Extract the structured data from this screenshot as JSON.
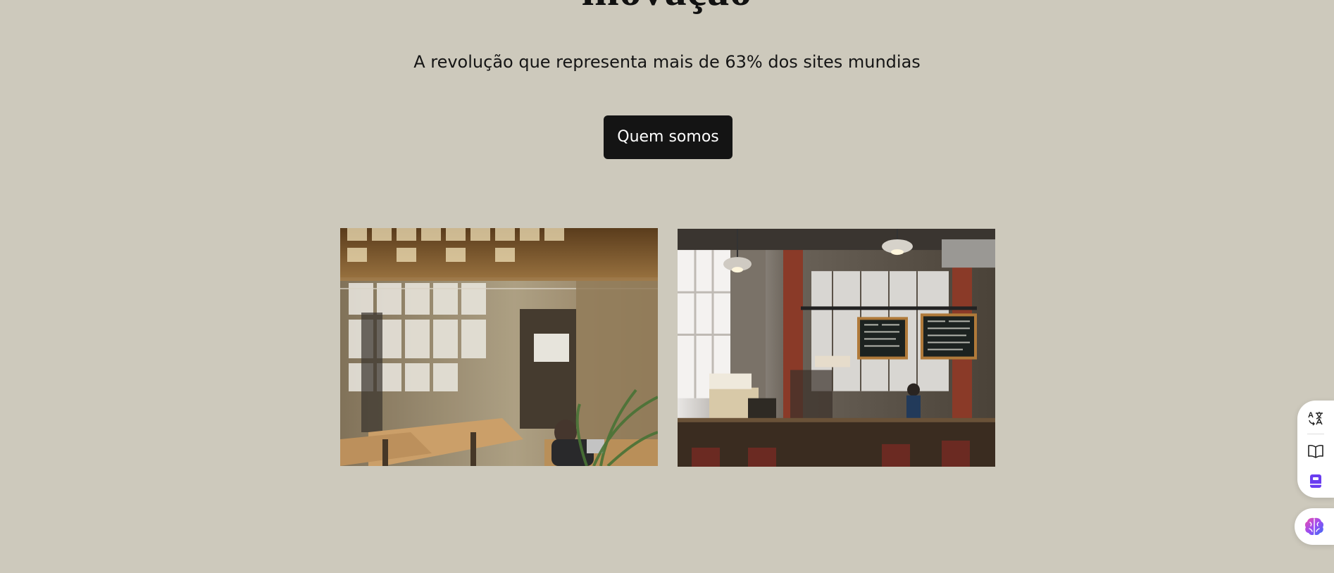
{
  "hero": {
    "title": "inovação",
    "subtitle": "A revolução que representa mais de 63% dos sites mundias",
    "cta_label": "Quem somos"
  },
  "gallery": [
    {
      "name": "office-photo",
      "icon": "photo-office"
    },
    {
      "name": "cafe-photo",
      "icon": "photo-cafe"
    }
  ],
  "side_toolbar": {
    "items": [
      "translate-icon",
      "book-icon",
      "bookmark-icon"
    ],
    "assistant_icon": "brain-icon"
  },
  "colors": {
    "background": "#cdc9bc",
    "button": "#141414",
    "button_text": "#ffffff",
    "accent_purple": "#6a3df0"
  }
}
